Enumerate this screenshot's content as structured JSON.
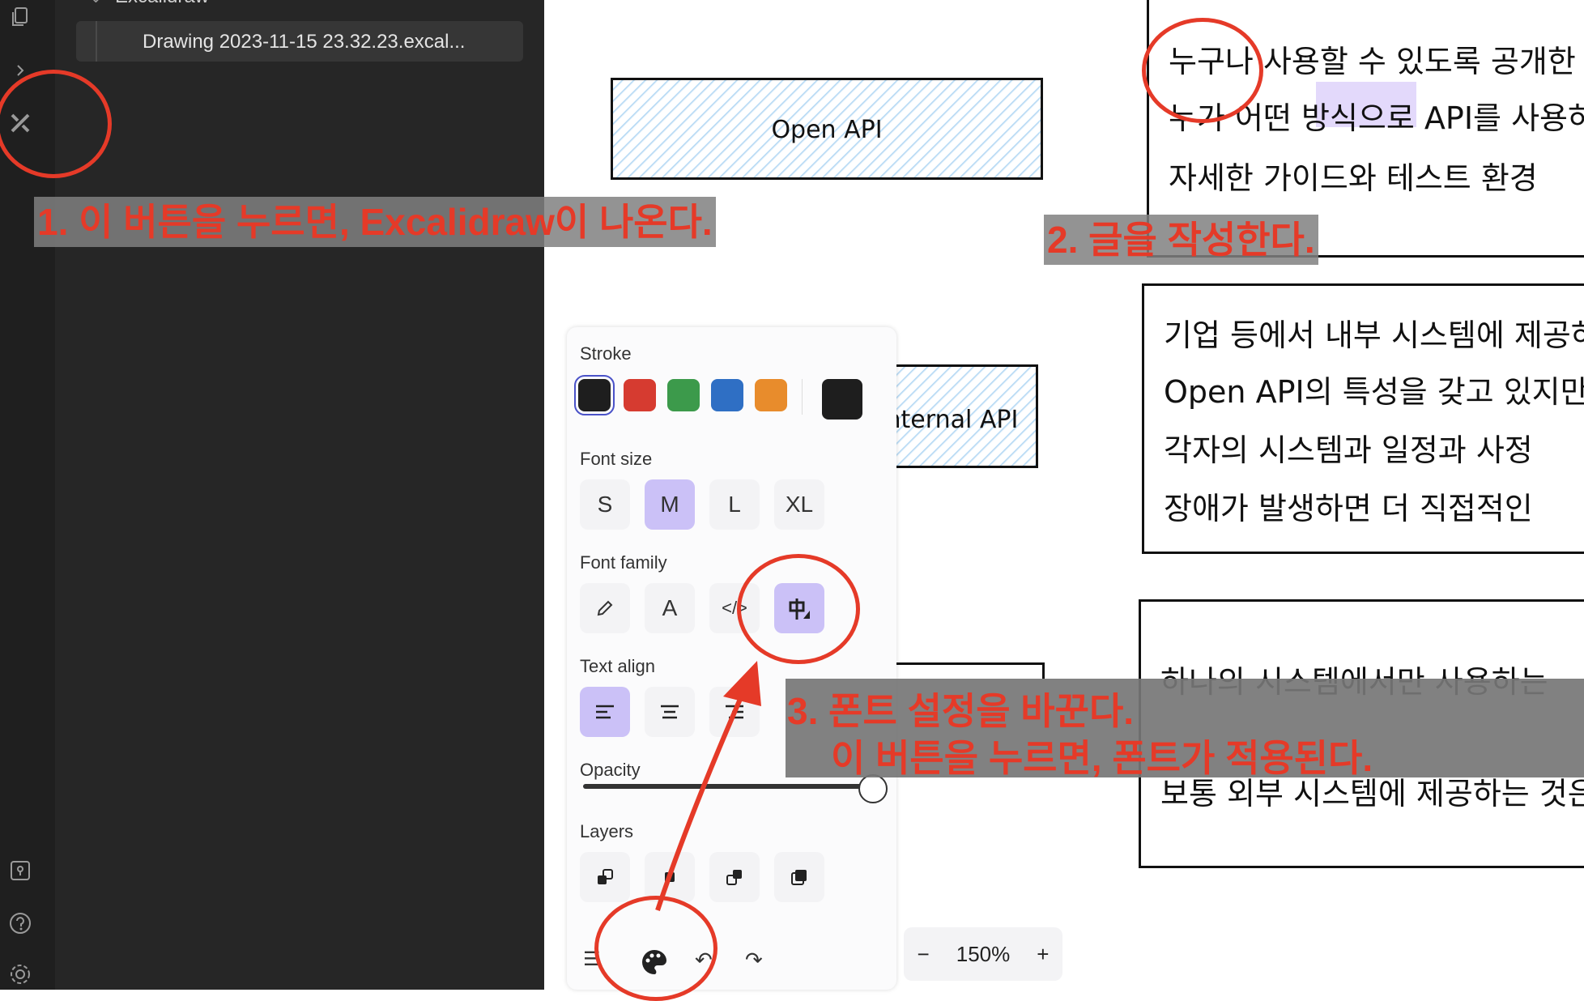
{
  "sidebar": {
    "folder_label": "Excalidraw",
    "file_name": "Drawing 2023-11-15 23.32.23.excal..."
  },
  "annotations": {
    "step1": "1. 이 버튼을 누르면, Excalidraw이 나온다.",
    "step2": "2. 글을 작성한다.",
    "step3_line1": "3. 폰트 설정을 바꾼다.",
    "step3_line2": "이 버튼을 누르면, 폰트가 적용된다."
  },
  "canvas": {
    "box1_label": "Open API",
    "box2_label": "Internal API",
    "panel1_lines": [
      "누구나 사용할 수 있도록 공개한",
      "누가 어떤 방식으로 API를 사용하",
      "자세한 가이드와 테스트 환경"
    ],
    "panel2_lines": [
      "기업 등에서 내부 시스템에 제공하",
      "Open API의 특성을 갖고 있지만,",
      "각자의 시스템과 일정과 사정",
      "장애가 발생하면 더 직접적인"
    ],
    "panel3_lines": [
      "하나의 시스템에서만 사용하는",
      "보통 외부 시스템에 제공하는 것은"
    ]
  },
  "properties": {
    "stroke_label": "Stroke",
    "stroke_colors": [
      "#1e1e1e",
      "#d63b30",
      "#3c9a4b",
      "#2f6fc4",
      "#e88c2c"
    ],
    "stroke_current": "#1e1e1e",
    "font_size_label": "Font size",
    "font_sizes": [
      "S",
      "M",
      "L",
      "XL"
    ],
    "font_size_selected": "M",
    "font_family_label": "Font family",
    "font_family_icons": [
      "pencil-icon",
      "normal-font-icon",
      "code-font-icon",
      "cjk-font-icon"
    ],
    "font_family_selected": "cjk-font-icon",
    "text_align_label": "Text align",
    "text_align_options": [
      "left",
      "center",
      "right"
    ],
    "text_align_selected": "left",
    "opacity_label": "Opacity",
    "opacity_value": 100,
    "layers_label": "Layers",
    "layers_icons": [
      "send-to-back-icon",
      "send-backward-icon",
      "bring-forward-icon",
      "bring-to-front-icon"
    ]
  },
  "toolbar": {
    "zoom": "150%",
    "zoom_out": "−",
    "zoom_in": "+"
  },
  "colors": {
    "annotation_red": "#e53a28",
    "selected_purple": "#cbc1f7",
    "hatch_blue": "#a8d2f2"
  }
}
